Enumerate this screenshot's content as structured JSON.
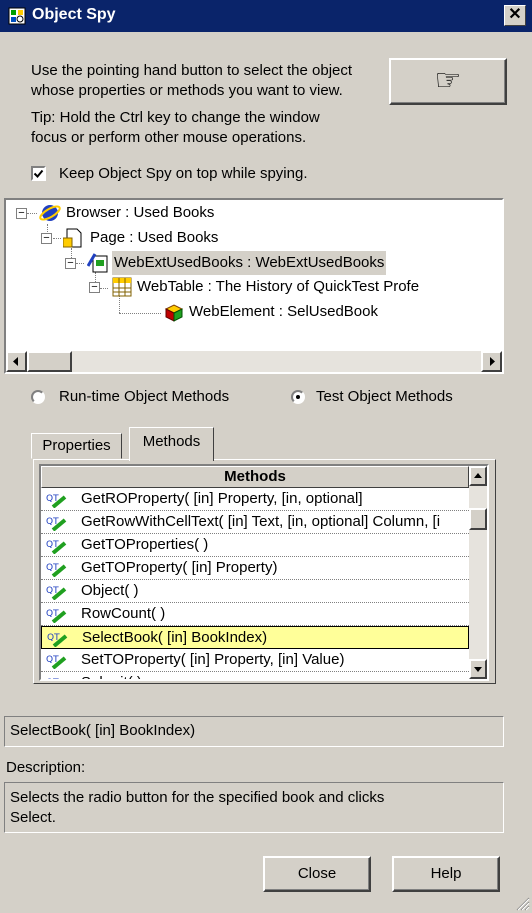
{
  "window": {
    "title": "Object Spy",
    "close_glyph": "✕"
  },
  "intro": {
    "line1": "Use the pointing hand button to select the object",
    "line2": "whose properties or methods you want to view.",
    "tip1": "Tip: Hold the Ctrl key to change the window",
    "tip2": "focus or perform other mouse operations.",
    "pointer_glyph": "☞"
  },
  "keep_on_top": {
    "label": "Keep Object Spy on top while spying.",
    "checked": true
  },
  "tree": [
    {
      "label": "Browser : Used Books",
      "icon": "browser-icon"
    },
    {
      "label": "Page : Used Books",
      "icon": "page-icon"
    },
    {
      "label": "WebExtUsedBooks : WebExtUsedBooks",
      "icon": "web-ext-icon"
    },
    {
      "label": "WebTable : The History of QuickTest Profe",
      "icon": "web-table-icon"
    },
    {
      "label": "WebElement : SelUsedBook",
      "icon": "web-element-icon"
    }
  ],
  "modes": {
    "runtime": "Run-time Object Methods",
    "test": "Test Object Methods"
  },
  "tabs": {
    "properties": "Properties",
    "methods": "Methods"
  },
  "methods": {
    "header": "Methods",
    "items": [
      "GetROProperty( [in] Property, [in, optional]",
      "GetRowWithCellText( [in] Text, [in, optional] Column, [i",
      "GetTOProperties( )",
      "GetTOProperty( [in] Property)",
      "Object( )",
      "RowCount( )",
      "SelectBook( [in] BookIndex)",
      "SetTOProperty( [in] Property, [in] Value)",
      "Submit( )"
    ]
  },
  "selected_signature": "SelectBook( [in] BookIndex)",
  "description": {
    "label": "Description:",
    "line1": "Selects the radio button for the specified book and clicks",
    "line2": "Select."
  },
  "buttons": {
    "close": "Close",
    "help": "Help"
  },
  "colors": {
    "title_bar": "#0a246a",
    "selection": "#ffff99",
    "tree_highlight": "#d4d0c8"
  }
}
